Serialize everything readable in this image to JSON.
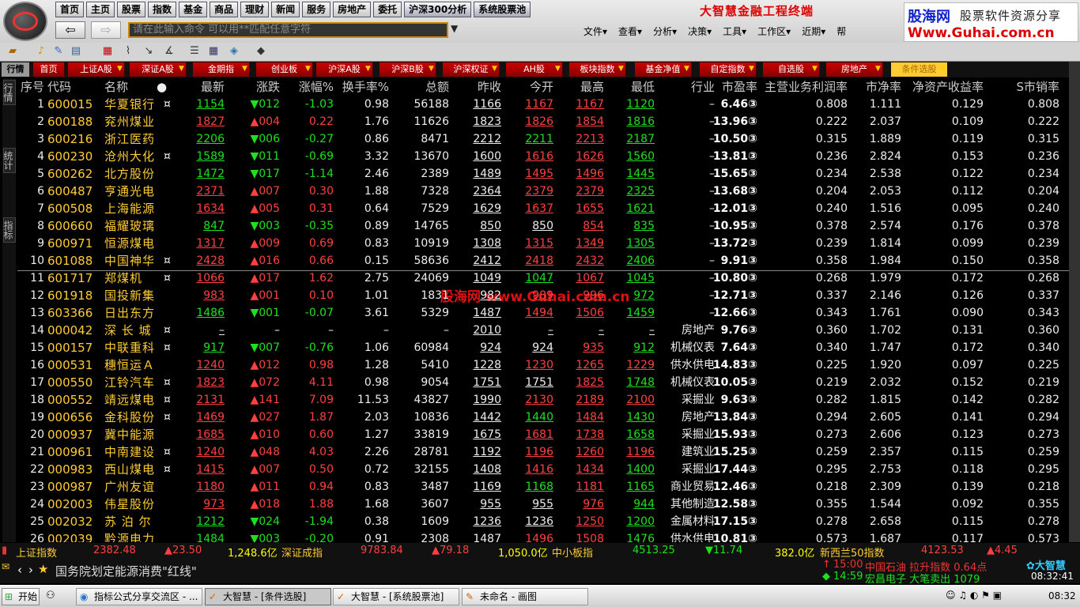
{
  "app": {
    "brand": "大智慧金融工程终端"
  },
  "watermark": {
    "line1": "股海网",
    "line2": "股票软件资源分享",
    "line3": "Www.Guhai.com.cn"
  },
  "overlay_watermark": "股海网 www.Guhai.com.cn",
  "nav": [
    "首页",
    "主页",
    "股票",
    "指数",
    "基金",
    "商品",
    "理财",
    "新闻",
    "服务",
    "房地产",
    "委托",
    "沪深300分析",
    "系统股票池"
  ],
  "command": {
    "placeholder": "请在此输入命令  可以用**匹配任意字符"
  },
  "menus": [
    "文件▾",
    "查看▾",
    "分析▾",
    "决策▾",
    "工具▾",
    "工作区▾",
    "近期▾",
    "帮"
  ],
  "tabs": [
    "行情",
    "首页",
    "上证A股",
    "深证A股",
    "金期指",
    "创业板",
    "沪深A股",
    "沪深B股",
    "沪深权证",
    "AH股",
    "板块指数",
    "基金净值",
    "自定指数",
    "自选股",
    "房地产",
    "条件选股"
  ],
  "side_tabs": [
    "行情",
    "统计",
    "指标"
  ],
  "columns": [
    "序号",
    "代码",
    "名称",
    "●",
    "最新",
    "涨跌",
    "涨幅%",
    "换手率%",
    "总额",
    "昨收",
    "今开",
    "最高",
    "最低",
    "行业",
    "市盈率",
    "主营业务利润率",
    "市净率",
    "净资产收益率",
    "S市销率"
  ],
  "rows": [
    [
      "1",
      "600015",
      "华夏银行",
      "¤",
      "1154",
      "▼012",
      "-1.03",
      "0.98",
      "56188",
      "1166",
      "1167",
      "1167",
      "1120",
      "–",
      "6.46③",
      "0.808",
      "1.111",
      "0.129",
      "0.808"
    ],
    [
      "2",
      "600188",
      "兖州煤业",
      "",
      "1827",
      "▲004",
      "0.22",
      "1.76",
      "11626",
      "1823",
      "1826",
      "1854",
      "1816",
      "–",
      "13.96③",
      "0.222",
      "2.037",
      "0.109",
      "0.222"
    ],
    [
      "3",
      "600216",
      "浙江医药",
      "",
      "2206",
      "▼006",
      "-0.27",
      "0.86",
      "8471",
      "2212",
      "2211",
      "2213",
      "2187",
      "–",
      "10.50③",
      "0.315",
      "1.889",
      "0.119",
      "0.315"
    ],
    [
      "4",
      "600230",
      "沧州大化",
      "¤",
      "1589",
      "▼011",
      "-0.69",
      "3.32",
      "13670",
      "1600",
      "1616",
      "1626",
      "1560",
      "–",
      "13.81③",
      "0.236",
      "2.824",
      "0.153",
      "0.236"
    ],
    [
      "5",
      "600262",
      "北方股份",
      "",
      "1472",
      "▼017",
      "-1.14",
      "2.46",
      "2389",
      "1489",
      "1495",
      "1496",
      "1445",
      "–",
      "15.65③",
      "0.234",
      "2.538",
      "0.122",
      "0.234"
    ],
    [
      "6",
      "600487",
      "亨通光电",
      "",
      "2371",
      "▲007",
      "0.30",
      "1.88",
      "7328",
      "2364",
      "2379",
      "2379",
      "2325",
      "–",
      "13.68③",
      "0.204",
      "2.053",
      "0.112",
      "0.204"
    ],
    [
      "7",
      "600508",
      "上海能源",
      "",
      "1634",
      "▲005",
      "0.31",
      "0.64",
      "7529",
      "1629",
      "1637",
      "1655",
      "1621",
      "–",
      "12.01③",
      "0.240",
      "1.516",
      "0.095",
      "0.240"
    ],
    [
      "8",
      "600660",
      "福耀玻璃",
      "",
      "847",
      "▼003",
      "-0.35",
      "0.89",
      "14765",
      "850",
      "850",
      "854",
      "835",
      "–",
      "10.95③",
      "0.378",
      "2.574",
      "0.176",
      "0.378"
    ],
    [
      "9",
      "600971",
      "恒源煤电",
      "",
      "1317",
      "▲009",
      "0.69",
      "0.83",
      "10919",
      "1308",
      "1315",
      "1349",
      "1305",
      "–",
      "13.72③",
      "0.239",
      "1.814",
      "0.099",
      "0.239"
    ],
    [
      "10",
      "601088",
      "中国神华",
      "¤",
      "2428",
      "▲016",
      "0.66",
      "0.15",
      "58636",
      "2412",
      "2418",
      "2432",
      "2406",
      "–",
      "9.91③",
      "0.358",
      "1.984",
      "0.150",
      "0.358"
    ],
    [
      "11",
      "601717",
      "郑煤机",
      "¤",
      "1066",
      "▲017",
      "1.62",
      "2.75",
      "24069",
      "1049",
      "1047",
      "1067",
      "1045",
      "–",
      "10.80③",
      "0.268",
      "1.979",
      "0.172",
      "0.268"
    ],
    [
      "12",
      "601918",
      "国投新集",
      "",
      "983",
      "▲001",
      "0.10",
      "1.01",
      "1831",
      "982",
      "989",
      "996",
      "972",
      "–",
      "12.71③",
      "0.337",
      "2.146",
      "0.126",
      "0.337"
    ],
    [
      "13",
      "603366",
      "日出东方",
      "",
      "1486",
      "▼001",
      "-0.07",
      "3.61",
      "5329",
      "1487",
      "1494",
      "1506",
      "1459",
      "–",
      "12.66③",
      "0.343",
      "1.761",
      "0.090",
      "0.343"
    ],
    [
      "14",
      "000042",
      "深 长 城",
      "¤",
      "–",
      "–",
      "–",
      "–",
      "–",
      "2010",
      "–",
      "–",
      "–",
      "房地产",
      "9.76③",
      "0.360",
      "1.702",
      "0.131",
      "0.360"
    ],
    [
      "15",
      "000157",
      "中联重科",
      "¤",
      "917",
      "▼007",
      "-0.76",
      "1.06",
      "60984",
      "924",
      "924",
      "935",
      "912",
      "机械仪表",
      "7.64③",
      "0.340",
      "1.747",
      "0.172",
      "0.340"
    ],
    [
      "16",
      "000531",
      "穗恒运Ａ",
      "",
      "1240",
      "▲012",
      "0.98",
      "1.28",
      "5410",
      "1228",
      "1230",
      "1265",
      "1229",
      "供水供电",
      "14.83③",
      "0.225",
      "1.920",
      "0.097",
      "0.225"
    ],
    [
      "17",
      "000550",
      "江铃汽车",
      "¤",
      "1823",
      "▲072",
      "4.11",
      "0.98",
      "9054",
      "1751",
      "1751",
      "1825",
      "1748",
      "机械仪表",
      "10.05③",
      "0.219",
      "2.032",
      "0.152",
      "0.219"
    ],
    [
      "18",
      "000552",
      "靖远煤电",
      "¤",
      "2131",
      "▲141",
      "7.09",
      "11.53",
      "43827",
      "1990",
      "2130",
      "2189",
      "2100",
      "采掘业",
      "9.63③",
      "0.282",
      "1.815",
      "0.142",
      "0.282"
    ],
    [
      "19",
      "000656",
      "金科股份",
      "¤",
      "1469",
      "▲027",
      "1.87",
      "2.03",
      "10836",
      "1442",
      "1440",
      "1484",
      "1430",
      "房地产",
      "13.84③",
      "0.294",
      "2.605",
      "0.141",
      "0.294"
    ],
    [
      "20",
      "000937",
      "冀中能源",
      "",
      "1685",
      "▲010",
      "0.60",
      "1.27",
      "33819",
      "1675",
      "1681",
      "1738",
      "1658",
      "采掘业",
      "15.93③",
      "0.273",
      "2.606",
      "0.123",
      "0.273"
    ],
    [
      "21",
      "000961",
      "中南建设",
      "¤",
      "1240",
      "▲048",
      "4.03",
      "2.26",
      "28781",
      "1192",
      "1196",
      "1260",
      "1196",
      "建筑业",
      "15.25③",
      "0.259",
      "2.357",
      "0.115",
      "0.259"
    ],
    [
      "22",
      "000983",
      "西山煤电",
      "¤",
      "1415",
      "▲007",
      "0.50",
      "0.72",
      "32155",
      "1408",
      "1416",
      "1434",
      "1400",
      "采掘业",
      "17.44③",
      "0.295",
      "2.753",
      "0.118",
      "0.295"
    ],
    [
      "23",
      "000987",
      "广州友谊",
      "",
      "1180",
      "▲011",
      "0.94",
      "0.83",
      "3487",
      "1169",
      "1168",
      "1181",
      "1165",
      "商业贸易",
      "12.46③",
      "0.218",
      "2.309",
      "0.139",
      "0.218"
    ],
    [
      "24",
      "002003",
      "伟星股份",
      "",
      "973",
      "▲018",
      "1.88",
      "1.68",
      "3607",
      "955",
      "955",
      "976",
      "944",
      "其他制造",
      "12.58③",
      "0.355",
      "1.544",
      "0.092",
      "0.355"
    ],
    [
      "25",
      "002032",
      "苏 泊 尔",
      "",
      "1212",
      "▼024",
      "-1.94",
      "0.38",
      "1609",
      "1236",
      "1236",
      "1250",
      "1200",
      "金属材料",
      "17.15③",
      "0.278",
      "2.658",
      "0.115",
      "0.278"
    ],
    [
      "26",
      "002039",
      "黔源电力",
      "",
      "1484",
      "▼003",
      "-0.20",
      "0.91",
      "2308",
      "1487",
      "1496",
      "1508",
      "1476",
      "供水供电",
      "10.81③",
      "0.573",
      "1.687",
      "0.117",
      "0.573"
    ]
  ],
  "status": {
    "sh_name": "上证指数",
    "sh_value": "2382.48",
    "sh_change": "▲23.50",
    "sh_amount": "1,248.6亿",
    "sz_name": "深证成指",
    "sz_value": "9783.84",
    "sz_change": "▲79.18",
    "sz_amount": "1,050.0亿",
    "zx_name": "中小板指",
    "zx_value": "4513.25",
    "zx_change": "▼11.74",
    "zx_amount": "382.0亿",
    "xsb_name": "新西兰50指数",
    "xsb_value": "4123.53",
    "xsb_change": "▲4.45"
  },
  "news": {
    "headline": "国务院划定能源消费\"红线\""
  },
  "alerts": [
    {
      "time": "15:00",
      "text": "中国石油 拉升指数 0.64点"
    },
    {
      "time": "14:59",
      "text": "宏昌电子 大笔卖出 1079"
    }
  ],
  "clock": "08:32:41",
  "taskbar": {
    "start": "开始",
    "tasks": [
      "指标公式分享交流区 - ...",
      "大智慧 - [条件选股]",
      "大智慧 - [系统股票池]",
      "未命名 - 画图"
    ],
    "time": "08:32"
  },
  "colors": {
    "up": "#ff4040",
    "down": "#1fe01f",
    "neutral": "#eeeeee",
    "accent": "#ffcc33"
  }
}
